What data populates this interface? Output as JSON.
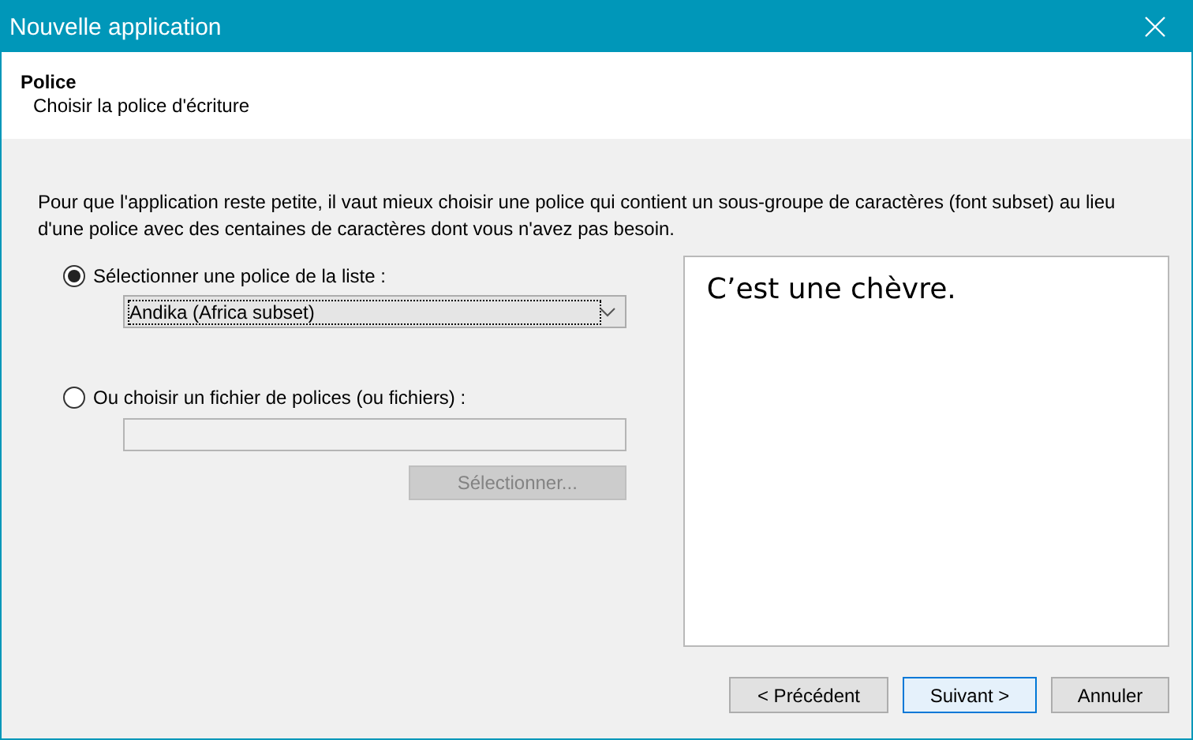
{
  "window": {
    "title": "Nouvelle application"
  },
  "header": {
    "title": "Police",
    "subtitle": "Choisir la police d'écriture"
  },
  "intro": "Pour que l'application reste petite, il vaut mieux choisir une police qui contient un sous-groupe de caractères (font subset) au lieu d'une police avec des centaines de caractères dont vous n'avez pas besoin.",
  "options": [
    {
      "kind": "dropdown",
      "label": "Sélectionner une police de la liste :",
      "selected": true,
      "value": "Andika (Africa subset)"
    },
    {
      "kind": "file",
      "label": "Ou choisir un fichier de polices (ou fichiers) :",
      "selected": false,
      "button": {
        "label": "Sélectionner...",
        "disabled": true
      }
    }
  ],
  "preview": {
    "text": "C’est une chèvre."
  },
  "buttons": [
    {
      "label": "< Précédent",
      "default": false
    },
    {
      "label": "Suivant >",
      "default": true
    },
    {
      "label": "Annuler",
      "default": false
    }
  ]
}
